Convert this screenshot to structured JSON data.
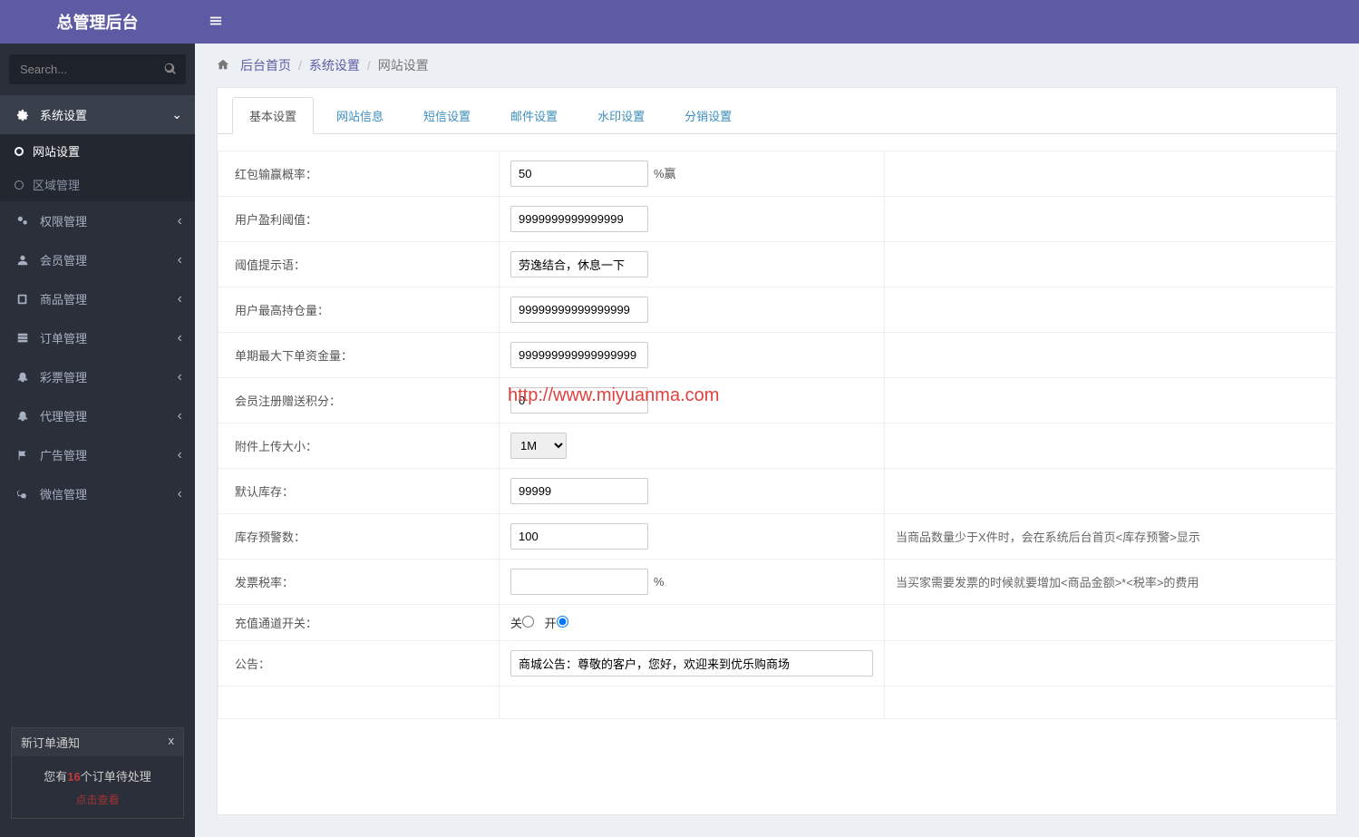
{
  "brand": "总管理后台",
  "search": {
    "placeholder": "Search..."
  },
  "nav": {
    "system": {
      "label": "系统设置",
      "sub_web": "网站设置",
      "sub_region": "区域管理"
    },
    "perm": "权限管理",
    "member": "会员管理",
    "product": "商品管理",
    "order": "订单管理",
    "lottery": "彩票管理",
    "agent": "代理管理",
    "ad": "广告管理",
    "wechat": "微信管理"
  },
  "notify": {
    "title": "新订单通知",
    "close": "x",
    "prefix": "您有",
    "count": "16",
    "suffix": "个订单待处理",
    "link": "点击查看"
  },
  "breadcrumb": {
    "home": "后台首页",
    "lvl2": "系统设置",
    "lvl3": "网站设置"
  },
  "tabs": {
    "basic": "基本设置",
    "site": "网站信息",
    "sms": "短信设置",
    "mail": "邮件设置",
    "watermark": "水印设置",
    "dist": "分销设置"
  },
  "form": {
    "win_rate": {
      "label": "红包输赢概率：",
      "value": "50",
      "suffix": "%赢"
    },
    "profit_threshold": {
      "label": "用户盈利阈值：",
      "value": "9999999999999999"
    },
    "threshold_tip": {
      "label": "阈值提示语：",
      "value": "劳逸结合，休息一下"
    },
    "max_hold": {
      "label": "用户最高持仓量：",
      "value": "99999999999999999"
    },
    "max_single": {
      "label": "单期最大下单资金量：",
      "value": "999999999999999999"
    },
    "reg_points": {
      "label": "会员注册赠送积分：",
      "value": "0"
    },
    "upload_size": {
      "label": "附件上传大小：",
      "value": "1M"
    },
    "default_stock": {
      "label": "默认库存：",
      "value": "99999"
    },
    "stock_warn": {
      "label": "库存预警数：",
      "value": "100",
      "help": "当商品数量少于X件时，会在系统后台首页<库存预警>显示"
    },
    "tax_rate": {
      "label": "发票税率：",
      "value": "",
      "suffix": "%",
      "help": "当买家需要发票的时候就要增加<商品金额>*<税率>的费用"
    },
    "recharge_switch": {
      "label": "充值通道开关：",
      "off": "关",
      "on": "开"
    },
    "notice": {
      "label": "公告：",
      "value": "商城公告：尊敬的客户，您好，欢迎来到优乐购商场"
    }
  },
  "watermark_url": "http://www.miyuanma.com"
}
